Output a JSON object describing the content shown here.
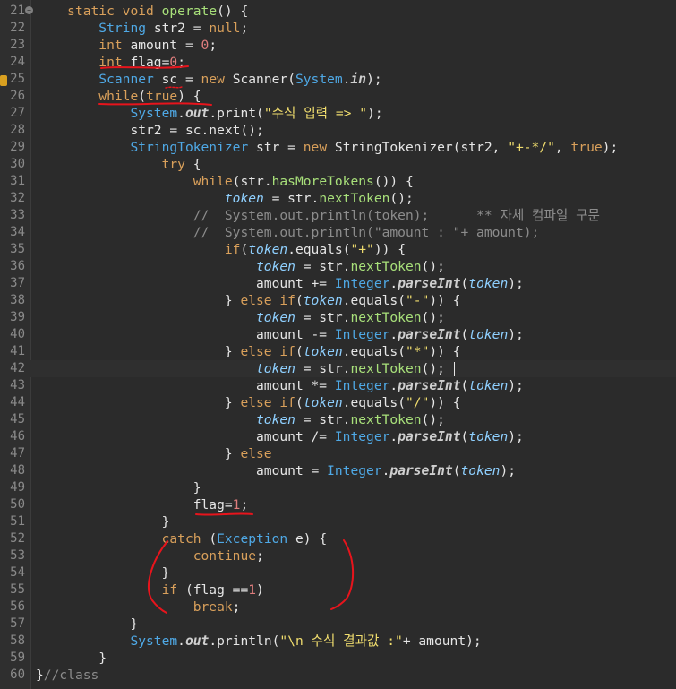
{
  "editor": {
    "lines": [
      {
        "n": "21",
        "fold": true,
        "tokens": [
          {
            "t": "    "
          },
          {
            "t": "static ",
            "c": "kw"
          },
          {
            "t": "void ",
            "c": "kw"
          },
          {
            "t": "operate",
            "c": "mth"
          },
          {
            "t": "() {"
          }
        ]
      },
      {
        "n": "22",
        "tokens": [
          {
            "t": "        "
          },
          {
            "t": "String ",
            "c": "type"
          },
          {
            "t": "str2 = "
          },
          {
            "t": "null",
            "c": "kw"
          },
          {
            "t": ";"
          }
        ]
      },
      {
        "n": "23",
        "tokens": [
          {
            "t": "        "
          },
          {
            "t": "int ",
            "c": "kw"
          },
          {
            "t": "amount = "
          },
          {
            "t": "0",
            "c": "num"
          },
          {
            "t": ";"
          }
        ]
      },
      {
        "n": "24",
        "tokens": [
          {
            "t": "        "
          },
          {
            "t": "int ",
            "c": "kw"
          },
          {
            "t": "flag="
          },
          {
            "t": "0",
            "c": "num"
          },
          {
            "t": ";"
          }
        ]
      },
      {
        "n": "25",
        "tokens": [
          {
            "t": "        "
          },
          {
            "t": "Scanner ",
            "c": "type"
          },
          {
            "t": "sc"
          },
          {
            "t": " = "
          },
          {
            "t": "new ",
            "c": "kw"
          },
          {
            "t": "Scanner("
          },
          {
            "t": "System",
            "c": "type"
          },
          {
            "t": "."
          },
          {
            "t": "in",
            "c": "smth"
          },
          {
            "t": ");"
          }
        ]
      },
      {
        "n": "26",
        "tokens": [
          {
            "t": "        "
          },
          {
            "t": "while",
            "c": "kw"
          },
          {
            "t": "("
          },
          {
            "t": "true",
            "c": "kw"
          },
          {
            "t": ") {"
          }
        ]
      },
      {
        "n": "27",
        "tokens": [
          {
            "t": "            "
          },
          {
            "t": "System",
            "c": "type"
          },
          {
            "t": "."
          },
          {
            "t": "out",
            "c": "smth"
          },
          {
            "t": ".print("
          },
          {
            "t": "\"수식 입력 => \"",
            "c": "str"
          },
          {
            "t": ");"
          }
        ]
      },
      {
        "n": "28",
        "tokens": [
          {
            "t": "            "
          },
          {
            "t": "str2 = sc.next();"
          }
        ]
      },
      {
        "n": "29",
        "tokens": [
          {
            "t": "            "
          },
          {
            "t": "StringTokenizer ",
            "c": "type"
          },
          {
            "t": "str = "
          },
          {
            "t": "new ",
            "c": "kw"
          },
          {
            "t": "StringTokenizer(str2, "
          },
          {
            "t": "\"+-*/\"",
            "c": "str"
          },
          {
            "t": ", "
          },
          {
            "t": "true",
            "c": "kw"
          },
          {
            "t": ");"
          }
        ]
      },
      {
        "n": "30",
        "tokens": [
          {
            "t": "                "
          },
          {
            "t": "try ",
            "c": "kw"
          },
          {
            "t": "{"
          }
        ]
      },
      {
        "n": "31",
        "tokens": [
          {
            "t": "                    "
          },
          {
            "t": "while",
            "c": "kw"
          },
          {
            "t": "(str."
          },
          {
            "t": "hasMoreTokens",
            "c": "mth"
          },
          {
            "t": "()) {"
          }
        ]
      },
      {
        "n": "32",
        "tokens": [
          {
            "t": "                        "
          },
          {
            "t": "token",
            "c": "fld"
          },
          {
            "t": " = str."
          },
          {
            "t": "nextToken",
            "c": "mth"
          },
          {
            "t": "();"
          }
        ]
      },
      {
        "n": "33",
        "tokens": [
          {
            "t": "                    "
          },
          {
            "t": "//  System.out.println(token);      ** 자체 컴파일 구문",
            "c": "com"
          }
        ]
      },
      {
        "n": "34",
        "tokens": [
          {
            "t": "                    "
          },
          {
            "t": "//  System.out.println(\"amount : \"+ amount);",
            "c": "com"
          }
        ]
      },
      {
        "n": "35",
        "tokens": [
          {
            "t": "                        "
          },
          {
            "t": "if",
            "c": "kw"
          },
          {
            "t": "("
          },
          {
            "t": "token",
            "c": "fld"
          },
          {
            "t": ".equals("
          },
          {
            "t": "\"+\"",
            "c": "str"
          },
          {
            "t": ")) {"
          }
        ]
      },
      {
        "n": "36",
        "tokens": [
          {
            "t": "                            "
          },
          {
            "t": "token",
            "c": "fld"
          },
          {
            "t": " = str."
          },
          {
            "t": "nextToken",
            "c": "mth"
          },
          {
            "t": "();"
          }
        ]
      },
      {
        "n": "37",
        "tokens": [
          {
            "t": "                            "
          },
          {
            "t": "amount += "
          },
          {
            "t": "Integer",
            "c": "type"
          },
          {
            "t": "."
          },
          {
            "t": "parseInt",
            "c": "smth"
          },
          {
            "t": "("
          },
          {
            "t": "token",
            "c": "fld"
          },
          {
            "t": ");"
          }
        ]
      },
      {
        "n": "38",
        "tokens": [
          {
            "t": "                        "
          },
          {
            "t": "} "
          },
          {
            "t": "else if",
            "c": "kw"
          },
          {
            "t": "("
          },
          {
            "t": "token",
            "c": "fld"
          },
          {
            "t": ".equals("
          },
          {
            "t": "\"-\"",
            "c": "str"
          },
          {
            "t": ")) {"
          }
        ]
      },
      {
        "n": "39",
        "tokens": [
          {
            "t": "                            "
          },
          {
            "t": "token",
            "c": "fld"
          },
          {
            "t": " = str."
          },
          {
            "t": "nextToken",
            "c": "mth"
          },
          {
            "t": "();"
          }
        ]
      },
      {
        "n": "40",
        "tokens": [
          {
            "t": "                            "
          },
          {
            "t": "amount -= "
          },
          {
            "t": "Integer",
            "c": "type"
          },
          {
            "t": "."
          },
          {
            "t": "parseInt",
            "c": "smth"
          },
          {
            "t": "("
          },
          {
            "t": "token",
            "c": "fld"
          },
          {
            "t": ");"
          }
        ]
      },
      {
        "n": "41",
        "tokens": [
          {
            "t": "                        "
          },
          {
            "t": "} "
          },
          {
            "t": "else if",
            "c": "kw"
          },
          {
            "t": "("
          },
          {
            "t": "token",
            "c": "fld"
          },
          {
            "t": ".equals("
          },
          {
            "t": "\"*\"",
            "c": "str"
          },
          {
            "t": ")) {"
          }
        ]
      },
      {
        "n": "42",
        "current": true,
        "tokens": [
          {
            "t": "                            "
          },
          {
            "t": "token",
            "c": "fld"
          },
          {
            "t": " = str."
          },
          {
            "t": "nextToken",
            "c": "mth"
          },
          {
            "t": "();"
          }
        ]
      },
      {
        "n": "43",
        "tokens": [
          {
            "t": "                            "
          },
          {
            "t": "amount *= "
          },
          {
            "t": "Integer",
            "c": "type"
          },
          {
            "t": "."
          },
          {
            "t": "parseInt",
            "c": "smth"
          },
          {
            "t": "("
          },
          {
            "t": "token",
            "c": "fld"
          },
          {
            "t": ");"
          }
        ]
      },
      {
        "n": "44",
        "tokens": [
          {
            "t": "                        "
          },
          {
            "t": "} "
          },
          {
            "t": "else if",
            "c": "kw"
          },
          {
            "t": "("
          },
          {
            "t": "token",
            "c": "fld"
          },
          {
            "t": ".equals("
          },
          {
            "t": "\"/\"",
            "c": "str"
          },
          {
            "t": ")) {"
          }
        ]
      },
      {
        "n": "45",
        "tokens": [
          {
            "t": "                            "
          },
          {
            "t": "token",
            "c": "fld"
          },
          {
            "t": " = str."
          },
          {
            "t": "nextToken",
            "c": "mth"
          },
          {
            "t": "();"
          }
        ]
      },
      {
        "n": "46",
        "tokens": [
          {
            "t": "                            "
          },
          {
            "t": "amount /= "
          },
          {
            "t": "Integer",
            "c": "type"
          },
          {
            "t": "."
          },
          {
            "t": "parseInt",
            "c": "smth"
          },
          {
            "t": "("
          },
          {
            "t": "token",
            "c": "fld"
          },
          {
            "t": ");"
          }
        ]
      },
      {
        "n": "47",
        "tokens": [
          {
            "t": "                        "
          },
          {
            "t": "} "
          },
          {
            "t": "else",
            "c": "kw"
          }
        ]
      },
      {
        "n": "48",
        "tokens": [
          {
            "t": "                            "
          },
          {
            "t": "amount = "
          },
          {
            "t": "Integer",
            "c": "type"
          },
          {
            "t": "."
          },
          {
            "t": "parseInt",
            "c": "smth"
          },
          {
            "t": "("
          },
          {
            "t": "token",
            "c": "fld"
          },
          {
            "t": ");"
          }
        ]
      },
      {
        "n": "49",
        "tokens": [
          {
            "t": "                    "
          },
          {
            "t": "}"
          }
        ]
      },
      {
        "n": "50",
        "tokens": [
          {
            "t": "                    "
          },
          {
            "t": "flag="
          },
          {
            "t": "1",
            "c": "num"
          },
          {
            "t": ";"
          }
        ]
      },
      {
        "n": "51",
        "tokens": [
          {
            "t": "                "
          },
          {
            "t": "}"
          }
        ]
      },
      {
        "n": "52",
        "tokens": [
          {
            "t": "                "
          },
          {
            "t": "catch ",
            "c": "kw"
          },
          {
            "t": "("
          },
          {
            "t": "Exception ",
            "c": "type"
          },
          {
            "t": "e) {"
          }
        ]
      },
      {
        "n": "53",
        "tokens": [
          {
            "t": "                    "
          },
          {
            "t": "continue",
            "c": "kw"
          },
          {
            "t": ";"
          }
        ]
      },
      {
        "n": "54",
        "tokens": [
          {
            "t": "                "
          },
          {
            "t": "}"
          }
        ]
      },
      {
        "n": "55",
        "tokens": [
          {
            "t": "                "
          },
          {
            "t": "if ",
            "c": "kw"
          },
          {
            "t": "(flag =="
          },
          {
            "t": "1",
            "c": "num"
          },
          {
            "t": ")"
          }
        ]
      },
      {
        "n": "56",
        "tokens": [
          {
            "t": "                    "
          },
          {
            "t": "break",
            "c": "kw"
          },
          {
            "t": ";"
          }
        ]
      },
      {
        "n": "57",
        "tokens": [
          {
            "t": "            "
          },
          {
            "t": "}"
          }
        ]
      },
      {
        "n": "58",
        "tokens": [
          {
            "t": "            "
          },
          {
            "t": "System",
            "c": "type"
          },
          {
            "t": "."
          },
          {
            "t": "out",
            "c": "smth"
          },
          {
            "t": ".println("
          },
          {
            "t": "\"\\n 수식 결과값 :\"",
            "c": "str"
          },
          {
            "t": "+ amount);"
          }
        ]
      },
      {
        "n": "59",
        "tokens": [
          {
            "t": "        "
          },
          {
            "t": "}"
          }
        ]
      },
      {
        "n": "60",
        "tokens": [
          {
            "t": "}"
          },
          {
            "t": "//class",
            "c": "com"
          }
        ]
      }
    ],
    "annotation_color": "#e8141c",
    "colors": {
      "background": "#2b2b2b",
      "keyword": "#d9a05b",
      "type": "#4fa9e6",
      "string": "#f0dd6e",
      "number": "#e07d7d",
      "comment": "#8c8c8c"
    }
  }
}
